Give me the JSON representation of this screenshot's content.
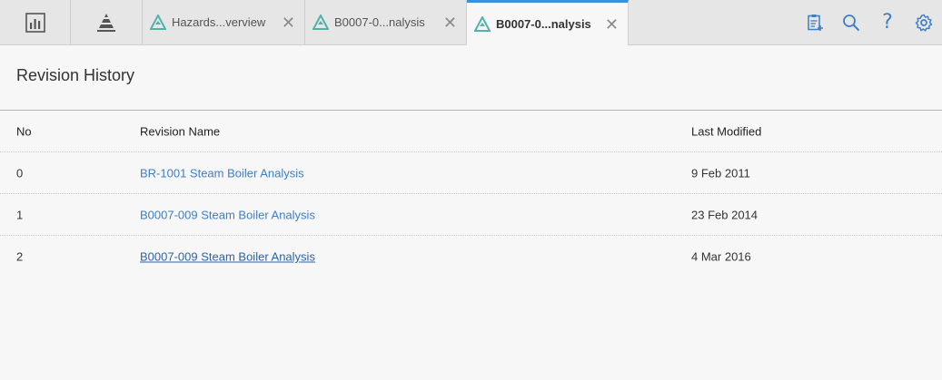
{
  "toolbar": {
    "tabs": [
      {
        "label": "Hazards...verview",
        "close": "✕"
      },
      {
        "label": "B0007-0...nalysis",
        "close": "✕"
      },
      {
        "label": "B0007-0...nalysis",
        "close": "✕"
      }
    ],
    "icons": [
      "dashboard-icon",
      "pyramid-icon",
      "clipboard-add-icon",
      "search-icon",
      "help-icon",
      "gear-icon"
    ],
    "help_glyph": "?"
  },
  "page": {
    "title": "Revision History"
  },
  "table": {
    "headers": {
      "no": "No",
      "name": "Revision Name",
      "modified": "Last Modified"
    },
    "rows": [
      {
        "no": "0",
        "name": "BR-1001 Steam Boiler Analysis",
        "modified": "9 Feb 2011"
      },
      {
        "no": "1",
        "name": "B0007-009 Steam Boiler Analysis",
        "modified": "23 Feb 2014"
      },
      {
        "no": "2",
        "name": "B0007-009 Steam Boiler Analysis",
        "modified": "4 Mar 2016"
      }
    ]
  },
  "colors": {
    "accent": "#3d8fd8",
    "link": "#3f7ec9",
    "tab_icon": "#4fb3a9"
  }
}
